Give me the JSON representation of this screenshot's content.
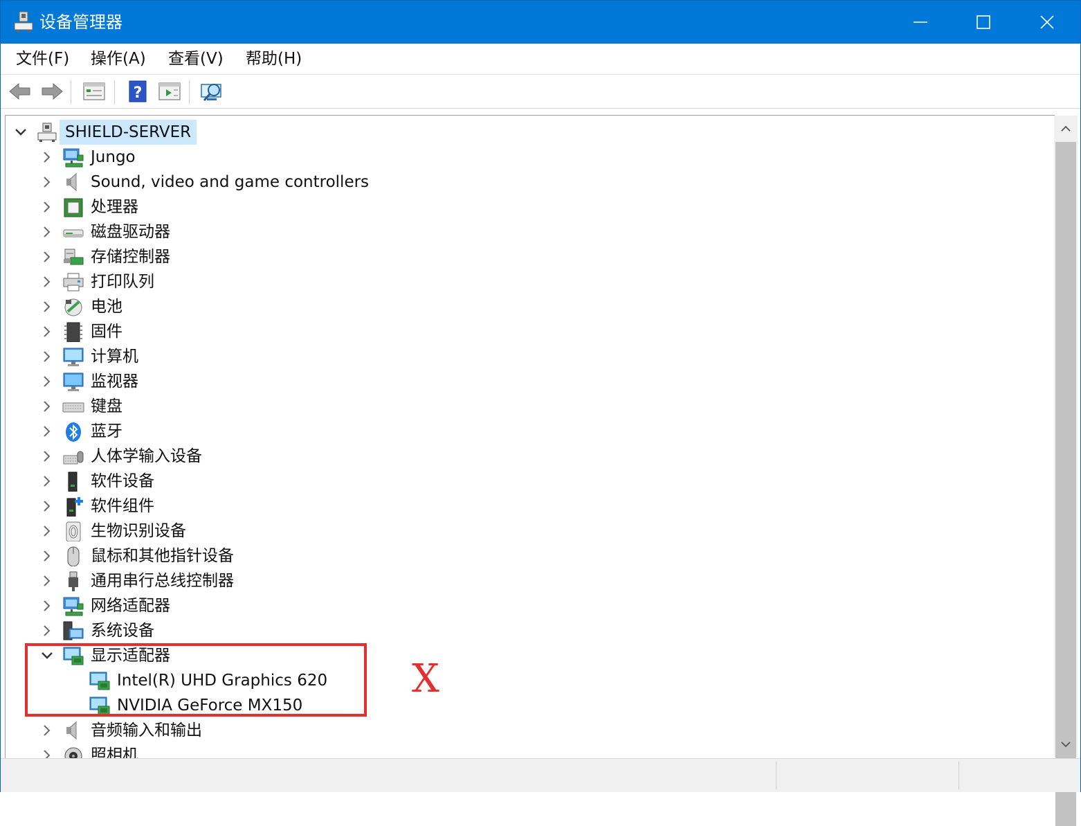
{
  "window": {
    "title": "设备管理器"
  },
  "menu": [
    "文件(F)",
    "操作(A)",
    "查看(V)",
    "帮助(H)"
  ],
  "toolbar": {
    "buttons": [
      "back-arrow-icon",
      "forward-arrow-icon",
      "properties-icon",
      "help-icon",
      "run-icon",
      "scan-hardware-icon"
    ]
  },
  "tree": {
    "root": "SHIELD-SERVER",
    "categories": [
      "Jungo",
      "Sound, video and game controllers",
      "处理器",
      "磁盘驱动器",
      "存储控制器",
      "打印队列",
      "电池",
      "固件",
      "计算机",
      "监视器",
      "键盘",
      "蓝牙",
      "人体学输入设备",
      "软件设备",
      "软件组件",
      "生物识别设备",
      "鼠标和其他指针设备",
      "通用串行总线控制器",
      "网络适配器",
      "系统设备",
      "显示适配器",
      "音频输入和输出",
      "照相机"
    ],
    "display_adapters": [
      "Intel(R) UHD Graphics 620",
      "NVIDIA GeForce MX150"
    ]
  },
  "annotation": {
    "mark": "X",
    "color": "#e3302f"
  },
  "colors": {
    "titlebar": "#0078d7",
    "selection": "#cce8ff"
  }
}
